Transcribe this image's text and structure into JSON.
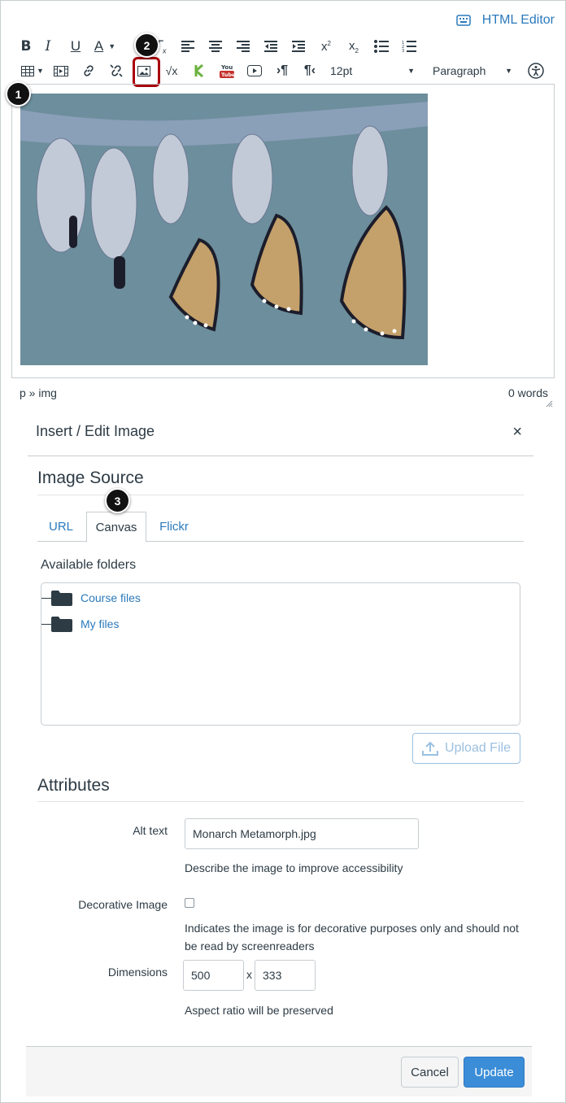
{
  "editor": {
    "html_editor_label": "HTML Editor",
    "toolbar": {
      "font_size": "12pt",
      "block_format": "Paragraph"
    },
    "status_path": "p » img",
    "word_count": "0 words"
  },
  "callouts": {
    "one": "1",
    "two": "2",
    "three": "3"
  },
  "dialog": {
    "title": "Insert / Edit Image",
    "close_glyph": "×",
    "image_source_heading": "Image Source",
    "tabs": [
      "URL",
      "Canvas",
      "Flickr"
    ],
    "active_tab": "Canvas",
    "available_folders_label": "Available folders",
    "folders": [
      "Course files",
      "My files"
    ],
    "upload_label": "Upload File",
    "attributes_heading": "Attributes",
    "alt_text_label": "Alt text",
    "alt_text_value": "Monarch Metamorph.jpg",
    "alt_text_hint": "Describe the image to improve accessibility",
    "decorative_label": "Decorative Image",
    "decorative_checked": false,
    "decorative_hint_1": "Indicates the image is for decorative purposes only and should not",
    "decorative_hint_2": "be read by screenreaders",
    "dimensions_label": "Dimensions",
    "width_value": "500",
    "height_value": "333",
    "times_glyph": "x",
    "aspect_hint": "Aspect ratio will be preserved",
    "cancel_label": "Cancel",
    "update_label": "Update"
  },
  "colors": {
    "link": "#2b7abc",
    "highlight": "#a8000b",
    "primary": "#3b8dd7"
  }
}
